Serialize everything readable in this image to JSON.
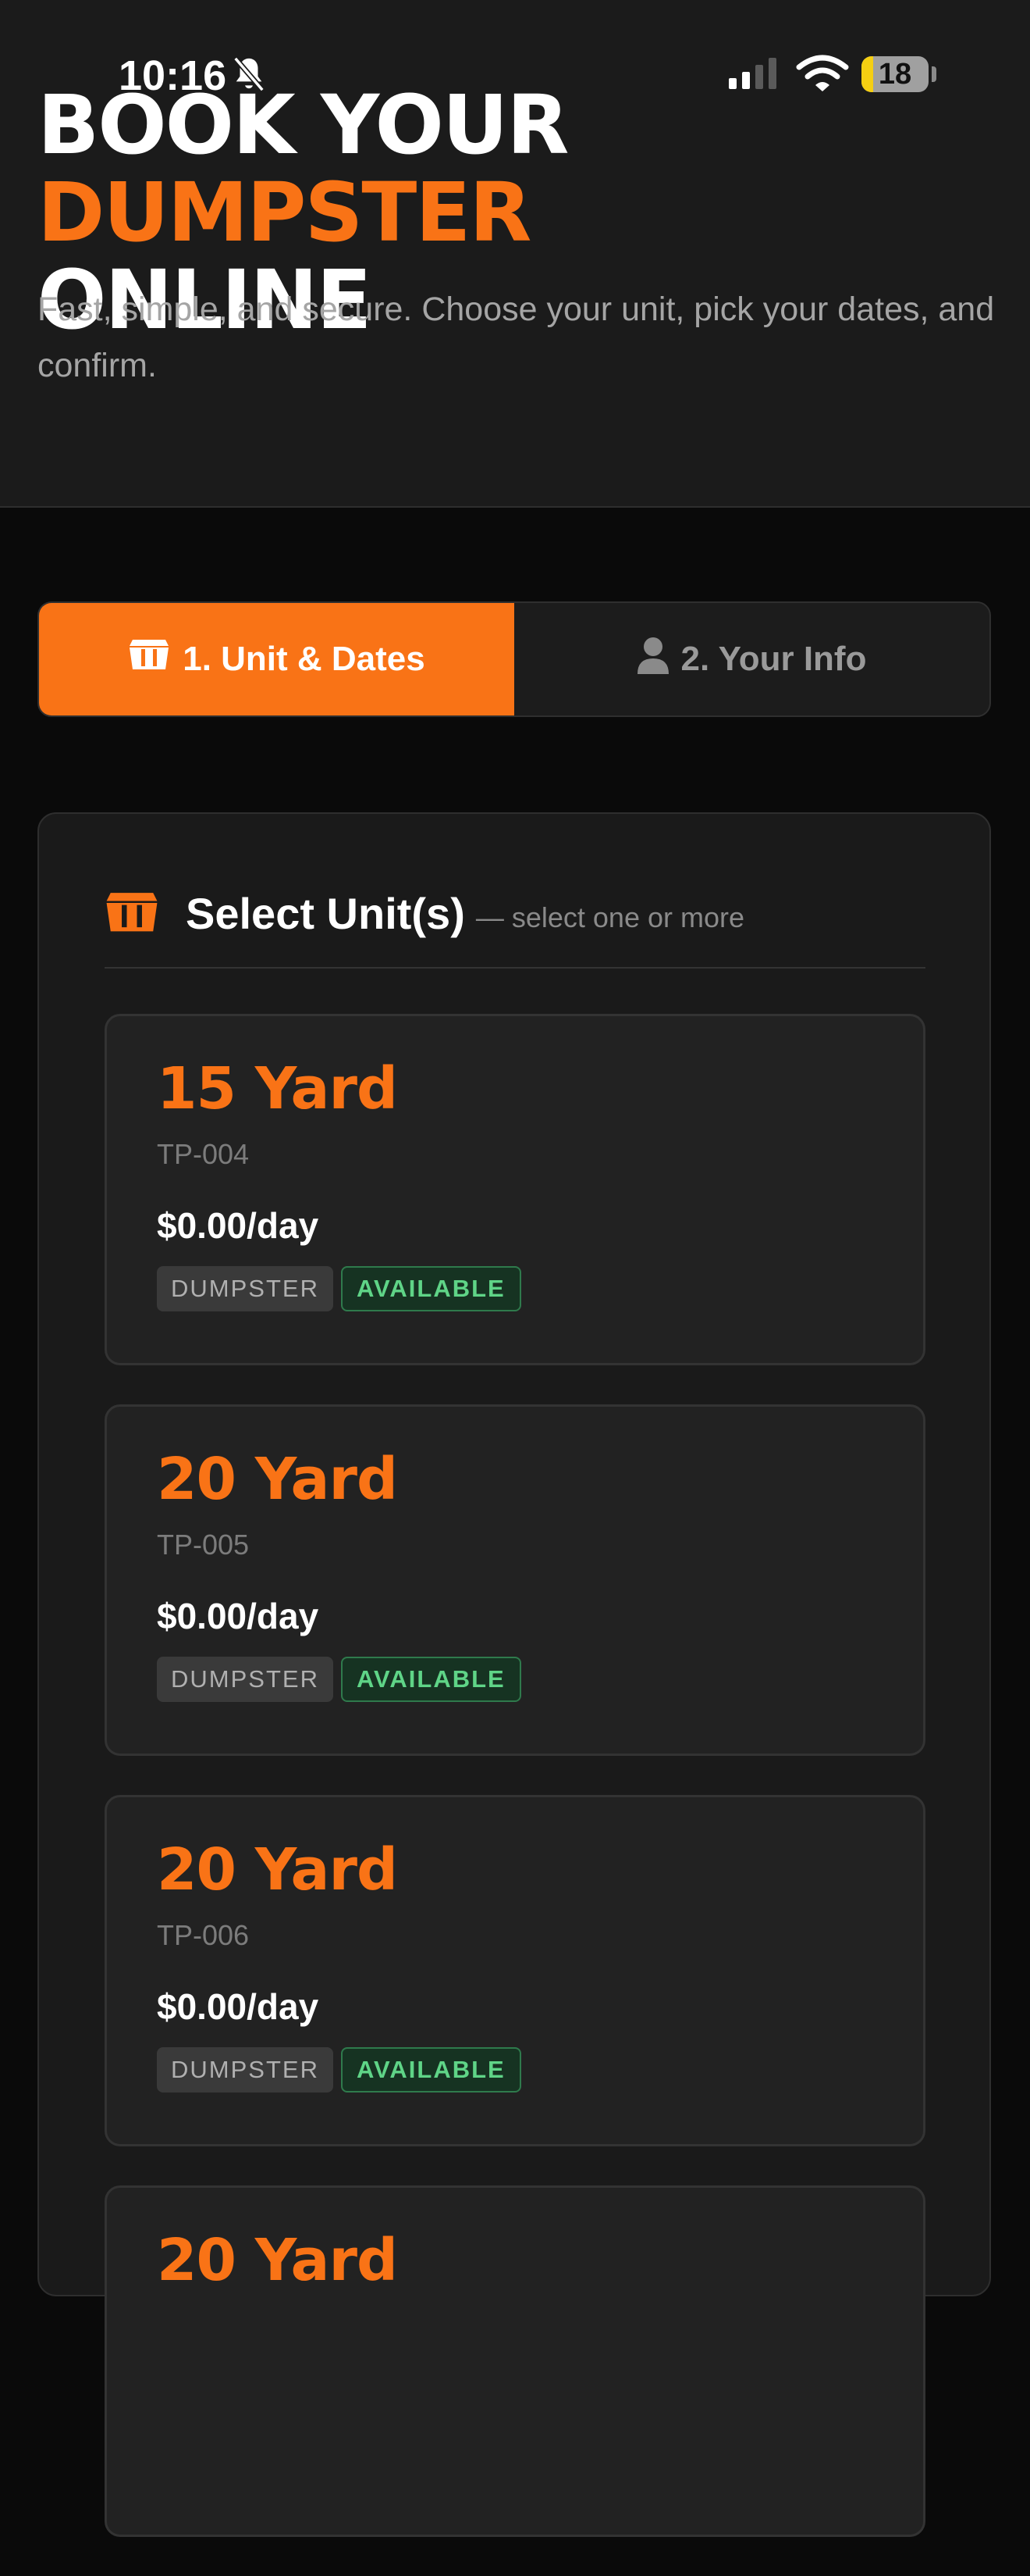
{
  "status_bar": {
    "time": "10:16",
    "battery": "18",
    "battery_level": 0.18
  },
  "hero": {
    "title_white": "BOOK YOUR ",
    "title_accent": "DUMPSTER",
    "title_line2": "ONLINE",
    "subtitle": "Fast, simple, and secure. Choose your unit, pick your dates, and confirm."
  },
  "tabs": [
    {
      "label": "1. Unit & Dates",
      "active": true,
      "icon": "dumpster-icon"
    },
    {
      "label": "2. Your Info",
      "active": false,
      "icon": "user-icon"
    }
  ],
  "section": {
    "title": "Select Unit(s)",
    "hint": "— select one or more",
    "icon": "dumpster-icon"
  },
  "units": [
    {
      "name": "15 Yard",
      "code": "TP-004",
      "price": "$0.00/day",
      "type": "DUMPSTER",
      "status": "AVAILABLE"
    },
    {
      "name": "20 Yard",
      "code": "TP-005",
      "price": "$0.00/day",
      "type": "DUMPSTER",
      "status": "AVAILABLE"
    },
    {
      "name": "20 Yard",
      "code": "TP-006",
      "price": "$0.00/day",
      "type": "DUMPSTER",
      "status": "AVAILABLE"
    },
    {
      "name": "20 Yard",
      "code": "",
      "price": "",
      "type": "",
      "status": ""
    }
  ],
  "colors": {
    "accent": "#f97316",
    "available": "#5fd487",
    "background": "#0a0a0a"
  }
}
